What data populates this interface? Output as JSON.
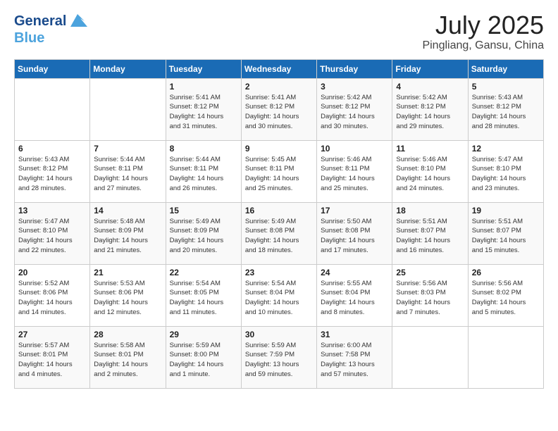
{
  "logo": {
    "line1": "General",
    "line2": "Blue"
  },
  "title": "July 2025",
  "subtitle": "Pingliang, Gansu, China",
  "weekdays": [
    "Sunday",
    "Monday",
    "Tuesday",
    "Wednesday",
    "Thursday",
    "Friday",
    "Saturday"
  ],
  "weeks": [
    [
      {
        "day": "",
        "info": ""
      },
      {
        "day": "",
        "info": ""
      },
      {
        "day": "1",
        "info": "Sunrise: 5:41 AM\nSunset: 8:12 PM\nDaylight: 14 hours\nand 31 minutes."
      },
      {
        "day": "2",
        "info": "Sunrise: 5:41 AM\nSunset: 8:12 PM\nDaylight: 14 hours\nand 30 minutes."
      },
      {
        "day": "3",
        "info": "Sunrise: 5:42 AM\nSunset: 8:12 PM\nDaylight: 14 hours\nand 30 minutes."
      },
      {
        "day": "4",
        "info": "Sunrise: 5:42 AM\nSunset: 8:12 PM\nDaylight: 14 hours\nand 29 minutes."
      },
      {
        "day": "5",
        "info": "Sunrise: 5:43 AM\nSunset: 8:12 PM\nDaylight: 14 hours\nand 28 minutes."
      }
    ],
    [
      {
        "day": "6",
        "info": "Sunrise: 5:43 AM\nSunset: 8:12 PM\nDaylight: 14 hours\nand 28 minutes."
      },
      {
        "day": "7",
        "info": "Sunrise: 5:44 AM\nSunset: 8:11 PM\nDaylight: 14 hours\nand 27 minutes."
      },
      {
        "day": "8",
        "info": "Sunrise: 5:44 AM\nSunset: 8:11 PM\nDaylight: 14 hours\nand 26 minutes."
      },
      {
        "day": "9",
        "info": "Sunrise: 5:45 AM\nSunset: 8:11 PM\nDaylight: 14 hours\nand 25 minutes."
      },
      {
        "day": "10",
        "info": "Sunrise: 5:46 AM\nSunset: 8:11 PM\nDaylight: 14 hours\nand 25 minutes."
      },
      {
        "day": "11",
        "info": "Sunrise: 5:46 AM\nSunset: 8:10 PM\nDaylight: 14 hours\nand 24 minutes."
      },
      {
        "day": "12",
        "info": "Sunrise: 5:47 AM\nSunset: 8:10 PM\nDaylight: 14 hours\nand 23 minutes."
      }
    ],
    [
      {
        "day": "13",
        "info": "Sunrise: 5:47 AM\nSunset: 8:10 PM\nDaylight: 14 hours\nand 22 minutes."
      },
      {
        "day": "14",
        "info": "Sunrise: 5:48 AM\nSunset: 8:09 PM\nDaylight: 14 hours\nand 21 minutes."
      },
      {
        "day": "15",
        "info": "Sunrise: 5:49 AM\nSunset: 8:09 PM\nDaylight: 14 hours\nand 20 minutes."
      },
      {
        "day": "16",
        "info": "Sunrise: 5:49 AM\nSunset: 8:08 PM\nDaylight: 14 hours\nand 18 minutes."
      },
      {
        "day": "17",
        "info": "Sunrise: 5:50 AM\nSunset: 8:08 PM\nDaylight: 14 hours\nand 17 minutes."
      },
      {
        "day": "18",
        "info": "Sunrise: 5:51 AM\nSunset: 8:07 PM\nDaylight: 14 hours\nand 16 minutes."
      },
      {
        "day": "19",
        "info": "Sunrise: 5:51 AM\nSunset: 8:07 PM\nDaylight: 14 hours\nand 15 minutes."
      }
    ],
    [
      {
        "day": "20",
        "info": "Sunrise: 5:52 AM\nSunset: 8:06 PM\nDaylight: 14 hours\nand 14 minutes."
      },
      {
        "day": "21",
        "info": "Sunrise: 5:53 AM\nSunset: 8:06 PM\nDaylight: 14 hours\nand 12 minutes."
      },
      {
        "day": "22",
        "info": "Sunrise: 5:54 AM\nSunset: 8:05 PM\nDaylight: 14 hours\nand 11 minutes."
      },
      {
        "day": "23",
        "info": "Sunrise: 5:54 AM\nSunset: 8:04 PM\nDaylight: 14 hours\nand 10 minutes."
      },
      {
        "day": "24",
        "info": "Sunrise: 5:55 AM\nSunset: 8:04 PM\nDaylight: 14 hours\nand 8 minutes."
      },
      {
        "day": "25",
        "info": "Sunrise: 5:56 AM\nSunset: 8:03 PM\nDaylight: 14 hours\nand 7 minutes."
      },
      {
        "day": "26",
        "info": "Sunrise: 5:56 AM\nSunset: 8:02 PM\nDaylight: 14 hours\nand 5 minutes."
      }
    ],
    [
      {
        "day": "27",
        "info": "Sunrise: 5:57 AM\nSunset: 8:01 PM\nDaylight: 14 hours\nand 4 minutes."
      },
      {
        "day": "28",
        "info": "Sunrise: 5:58 AM\nSunset: 8:01 PM\nDaylight: 14 hours\nand 2 minutes."
      },
      {
        "day": "29",
        "info": "Sunrise: 5:59 AM\nSunset: 8:00 PM\nDaylight: 14 hours\nand 1 minute."
      },
      {
        "day": "30",
        "info": "Sunrise: 5:59 AM\nSunset: 7:59 PM\nDaylight: 13 hours\nand 59 minutes."
      },
      {
        "day": "31",
        "info": "Sunrise: 6:00 AM\nSunset: 7:58 PM\nDaylight: 13 hours\nand 57 minutes."
      },
      {
        "day": "",
        "info": ""
      },
      {
        "day": "",
        "info": ""
      }
    ]
  ]
}
